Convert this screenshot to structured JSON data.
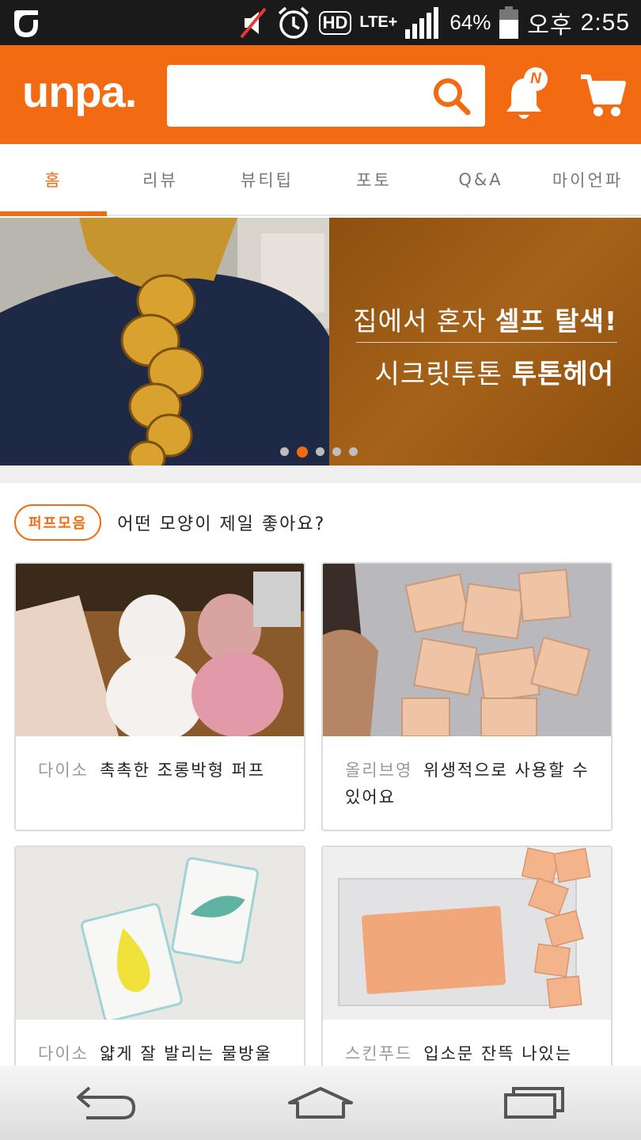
{
  "status_bar": {
    "battery": "64%",
    "network": "LTE+",
    "hd": "HD",
    "ampm": "오후",
    "time": "2:55"
  },
  "header": {
    "brand": "unpa.",
    "search_placeholder": "",
    "notification_badge": "N",
    "accent_color": "#f26a12"
  },
  "tabs": [
    {
      "label": "홈",
      "active": true
    },
    {
      "label": "리뷰"
    },
    {
      "label": "뷰티팁"
    },
    {
      "label": "포토"
    },
    {
      "label": "Q&A"
    },
    {
      "label": "마이언파"
    }
  ],
  "banner": {
    "line1_light_a": "집에서 ",
    "line1_bold_a": "혼자 ",
    "line1_bold_b": "셀프 탈색!",
    "line2_light": "시크릿투톤 ",
    "line2_bold": "투톤헤어",
    "slide_count": 5,
    "active_slide": 2
  },
  "section": {
    "tag": "퍼프모음",
    "question": "어떤 모양이 제일 좋아요?"
  },
  "cards": [
    {
      "brand": "다이소",
      "title": "촉촉한 조롱박형 퍼프"
    },
    {
      "brand": "올리브영",
      "title": "위생적으로 사용할 수 있어요"
    },
    {
      "brand": "다이소",
      "title": "얇게 잘 발리는 물방울"
    },
    {
      "brand": "스킨푸드",
      "title": "입소문 잔뜩 나있는 그"
    }
  ],
  "navbar": {
    "back": "back-icon",
    "home": "home-icon",
    "recents": "recents-icon"
  }
}
